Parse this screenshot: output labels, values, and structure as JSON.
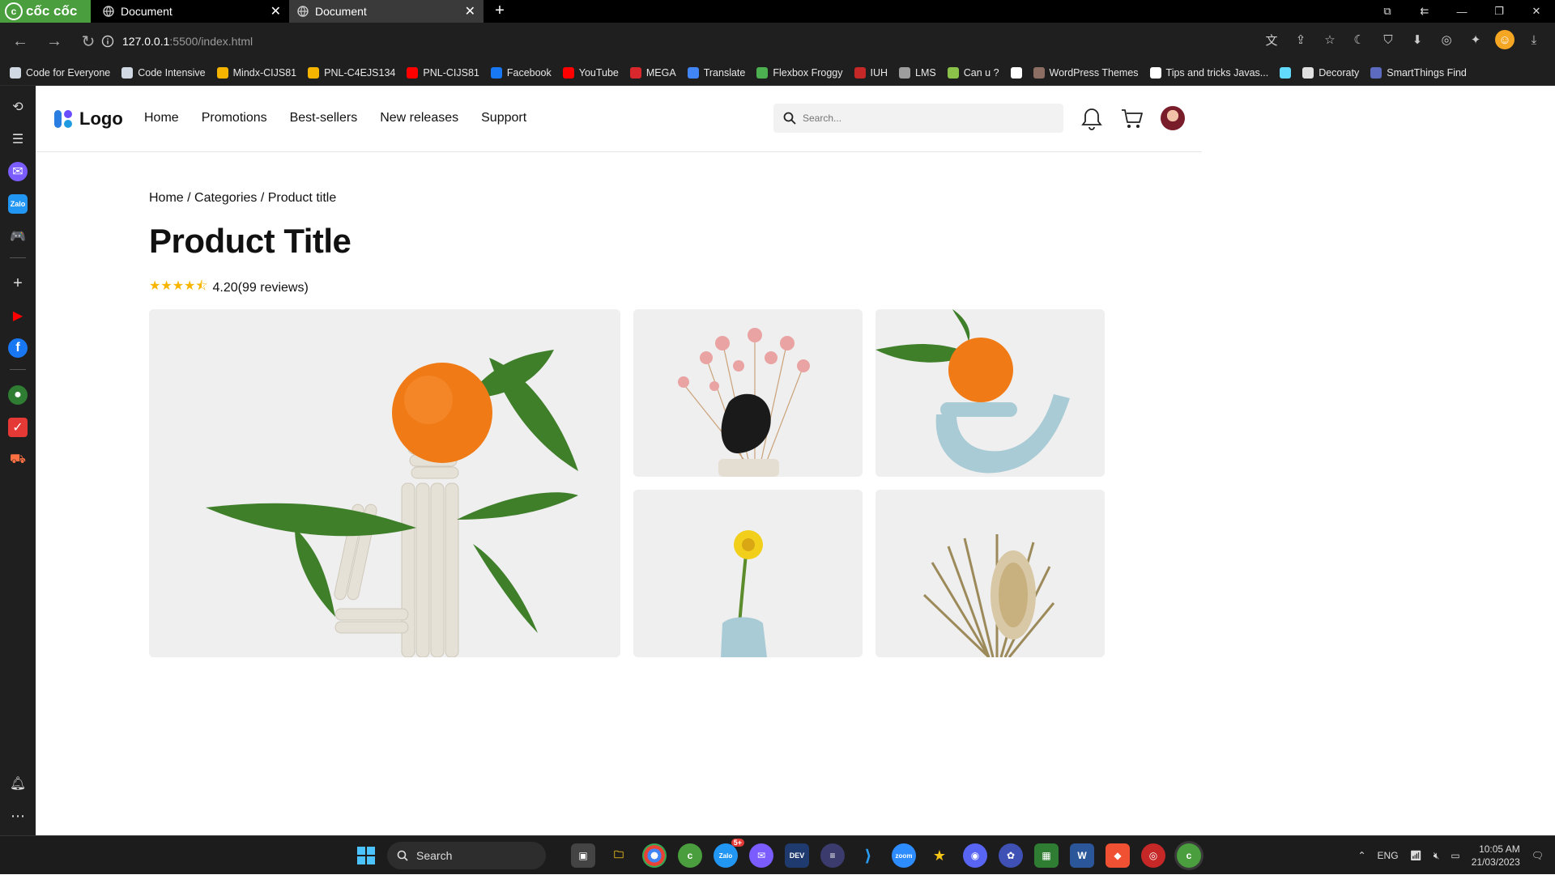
{
  "browser": {
    "brand": "cốc cốc",
    "tabs": [
      {
        "title": "Document",
        "active": true
      },
      {
        "title": "Document",
        "active": false
      }
    ],
    "url": {
      "host": "127.0.0.1",
      "path": ":5500/index.html"
    },
    "bookmarks": [
      {
        "label": "Code for Everyone",
        "icon": "folder-icon",
        "color": "#cfd8e3"
      },
      {
        "label": "Code Intensive",
        "icon": "folder-icon",
        "color": "#cfd8e3"
      },
      {
        "label": "Mindx-CIJS81",
        "icon": "drive-icon",
        "color": "#f5b400"
      },
      {
        "label": "PNL-C4EJS134",
        "icon": "drive-icon",
        "color": "#f5b400"
      },
      {
        "label": "PNL-CIJS81",
        "icon": "youtube-icon",
        "color": "#ff0000"
      },
      {
        "label": "Facebook",
        "icon": "facebook-icon",
        "color": "#1877f2"
      },
      {
        "label": "YouTube",
        "icon": "youtube-icon",
        "color": "#ff0000"
      },
      {
        "label": "MEGA",
        "icon": "mega-icon",
        "color": "#d9272e"
      },
      {
        "label": "Translate",
        "icon": "translate-icon",
        "color": "#4285f4"
      },
      {
        "label": "Flexbox Froggy",
        "icon": "frog-icon",
        "color": "#4caf50"
      },
      {
        "label": "IUH",
        "icon": "iuh-icon",
        "color": "#c62828"
      },
      {
        "label": "LMS",
        "icon": "lms-icon",
        "color": "#9e9e9e"
      },
      {
        "label": "Can u ?",
        "icon": "image-icon",
        "color": "#8bc34a"
      },
      {
        "label": "",
        "icon": "globe-icon",
        "color": "#ffffff"
      },
      {
        "label": "WordPress Themes",
        "icon": "wordpress-icon",
        "color": "#8d6e63"
      },
      {
        "label": "Tips and tricks Javas...",
        "icon": "a-icon",
        "color": "#ffffff"
      },
      {
        "label": "",
        "icon": "react-icon",
        "color": "#61dafb"
      },
      {
        "label": "Decoraty",
        "icon": "decoraty-icon",
        "color": "#e0e0e0"
      },
      {
        "label": "SmartThings Find",
        "icon": "smartthings-icon",
        "color": "#5c6bc0"
      }
    ]
  },
  "site": {
    "logo_text": "Logo",
    "nav": [
      "Home",
      "Promotions",
      "Best-sellers",
      "New releases",
      "Support"
    ],
    "search_placeholder": "Search...",
    "breadcrumb": "Home / Categories / Product title",
    "product_title": "Product Title",
    "rating": {
      "value": 4.2,
      "text": "4.20(99 reviews)",
      "max": 5
    }
  },
  "taskbar": {
    "search_label": "Search",
    "tray": {
      "lang": "ENG",
      "time": "10:05 AM",
      "date": "21/03/2023"
    },
    "zalo_badge": "5+"
  }
}
